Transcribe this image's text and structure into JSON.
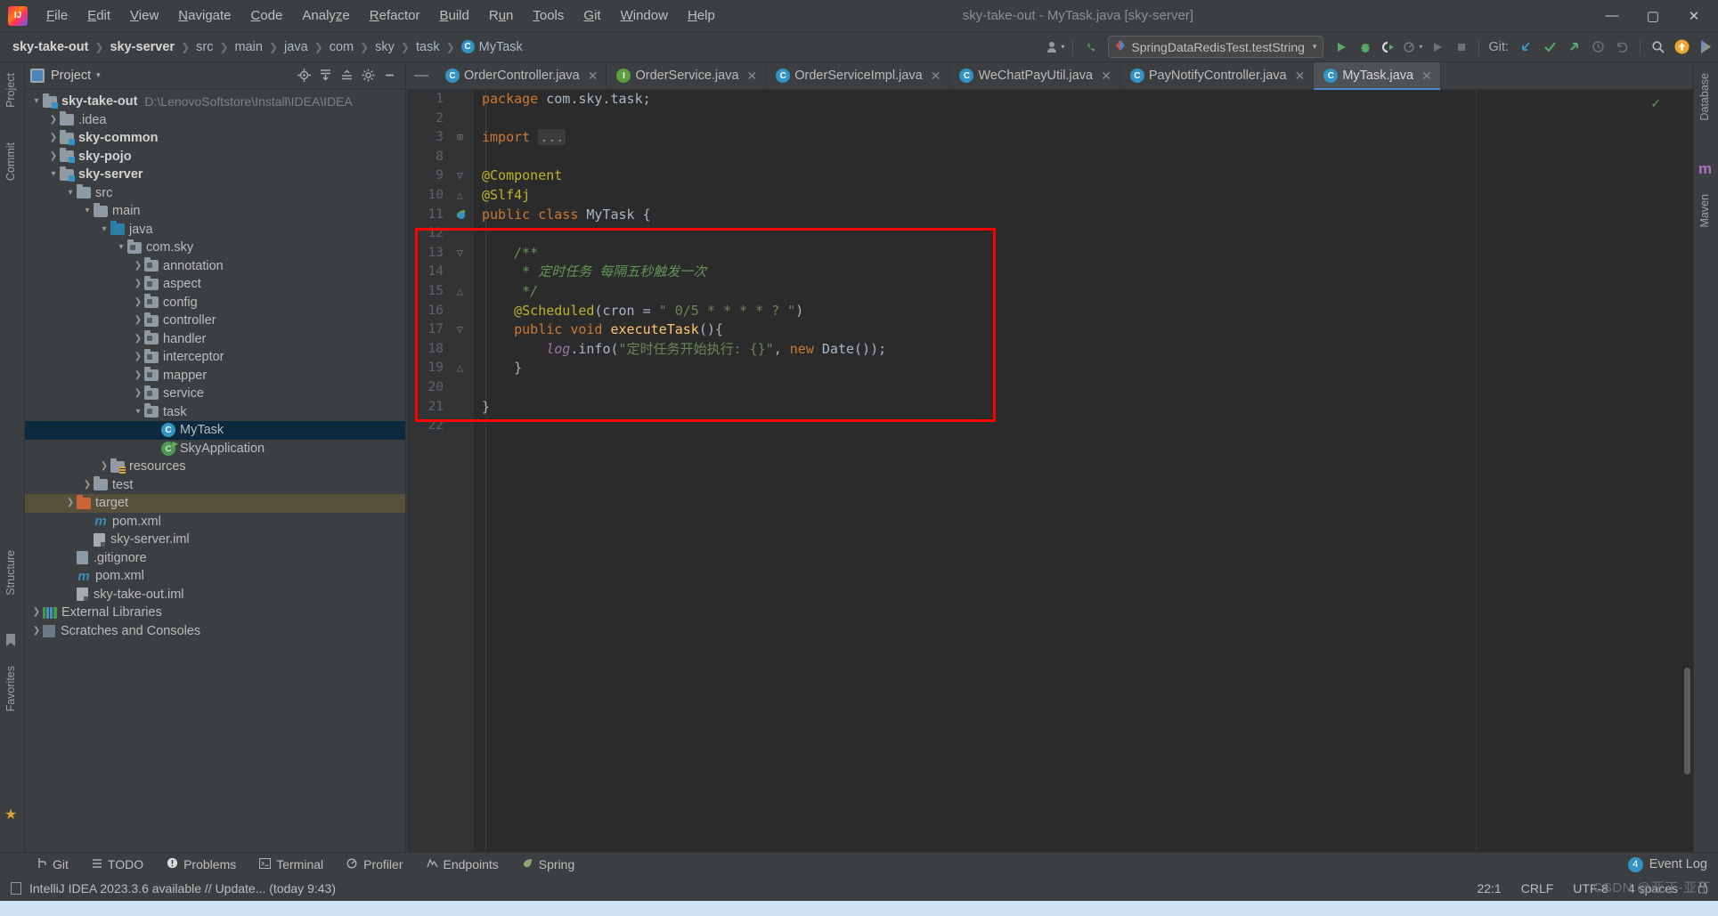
{
  "window": {
    "title": "sky-take-out - MyTask.java [sky-server]",
    "logo": "intellij-idea-logo",
    "minimize": "—",
    "maximize": "▢",
    "close": "✕"
  },
  "menu": [
    {
      "label": "File"
    },
    {
      "label": "Edit"
    },
    {
      "label": "View"
    },
    {
      "label": "Navigate"
    },
    {
      "label": "Code"
    },
    {
      "label": "Analyze"
    },
    {
      "label": "Refactor"
    },
    {
      "label": "Build"
    },
    {
      "label": "Run"
    },
    {
      "label": "Tools"
    },
    {
      "label": "Git"
    },
    {
      "label": "Window"
    },
    {
      "label": "Help"
    }
  ],
  "breadcrumb": {
    "items": [
      {
        "label": "sky-take-out",
        "bold": true
      },
      {
        "label": "sky-server",
        "bold": true
      },
      {
        "label": "src",
        "bold": false
      },
      {
        "label": "main",
        "bold": false
      },
      {
        "label": "java",
        "bold": false
      },
      {
        "label": "com",
        "bold": false
      },
      {
        "label": "sky",
        "bold": false
      },
      {
        "label": "task",
        "bold": false
      },
      {
        "label": "MyTask",
        "bold": false,
        "icon": "class-icon",
        "icon_letter": "C"
      }
    ],
    "separator": "❯"
  },
  "toolbar": {
    "profile_icon": "user-profile-icon",
    "profile_caret": "▾",
    "updates_icon": "updates-arrow-icon",
    "run_config": {
      "icon": "run-config-icon",
      "label": "SpringDataRedisTest.testString",
      "caret": "▾"
    },
    "run_icon": "run-icon",
    "debug_icon": "debug-icon",
    "run_coverage_icon": "run-with-coverage-icon",
    "profile_run_icon": "profiler-icon",
    "profile_caret2": "▾",
    "rerun_icon": "rerun-icon",
    "stop_icon": "stop-icon",
    "git_label": "Git:",
    "git_update_icon": "git-update-project-icon",
    "git_commit_icon": "git-commit-icon",
    "git_push_icon": "git-push-icon",
    "git_history_icon": "git-history-icon",
    "git_rollback_icon": "git-rollback-icon",
    "search_icon": "search-everywhere-icon",
    "notification_icon": "notification-update-icon",
    "ide_icon": "ide-feature-icon"
  },
  "left_strip": [
    {
      "label": "Project",
      "name": "tool-window-project"
    },
    {
      "label": "Commit",
      "name": "tool-window-commit"
    },
    {
      "label": "Structure",
      "name": "tool-window-structure"
    },
    {
      "label": "Favorites",
      "name": "tool-window-favorites"
    }
  ],
  "right_strip": [
    {
      "label": "Database",
      "name": "tool-window-database"
    },
    {
      "label": "Maven",
      "name": "tool-window-maven"
    }
  ],
  "project_panel": {
    "title": "Project",
    "caret": "▾",
    "actions": [
      {
        "icon": "locate-file-icon",
        "glyph": "⊕"
      },
      {
        "icon": "expand-all-icon",
        "glyph": "⤓"
      },
      {
        "icon": "collapse-all-icon",
        "glyph": "⤒"
      },
      {
        "icon": "settings-gear-icon",
        "glyph": "⚙"
      },
      {
        "icon": "hide-panel-icon",
        "glyph": "—"
      }
    ],
    "tree": [
      {
        "label": "sky-take-out",
        "path": "D:\\LenovoSoftstore\\Install\\IDEA\\IDEA",
        "indent": 0,
        "arrow": "▾",
        "icon": "module",
        "bold": true
      },
      {
        "label": ".idea",
        "indent": 1,
        "arrow": "❯",
        "icon": "folder",
        "bold": false
      },
      {
        "label": "sky-common",
        "indent": 1,
        "arrow": "❯",
        "icon": "module",
        "bold": true
      },
      {
        "label": "sky-pojo",
        "indent": 1,
        "arrow": "❯",
        "icon": "module",
        "bold": true
      },
      {
        "label": "sky-server",
        "indent": 1,
        "arrow": "▾",
        "icon": "module",
        "bold": true
      },
      {
        "label": "src",
        "indent": 2,
        "arrow": "▾",
        "icon": "folder",
        "bold": false
      },
      {
        "label": "main",
        "indent": 3,
        "arrow": "▾",
        "icon": "folder",
        "bold": false
      },
      {
        "label": "java",
        "indent": 4,
        "arrow": "▾",
        "icon": "srcjava",
        "bold": false
      },
      {
        "label": "com.sky",
        "indent": 5,
        "arrow": "▾",
        "icon": "pkg",
        "bold": false
      },
      {
        "label": "annotation",
        "indent": 6,
        "arrow": "❯",
        "icon": "pkg",
        "bold": false
      },
      {
        "label": "aspect",
        "indent": 6,
        "arrow": "❯",
        "icon": "pkg",
        "bold": false
      },
      {
        "label": "config",
        "indent": 6,
        "arrow": "❯",
        "icon": "pkg",
        "bold": false
      },
      {
        "label": "controller",
        "indent": 6,
        "arrow": "❯",
        "icon": "pkg",
        "bold": false
      },
      {
        "label": "handler",
        "indent": 6,
        "arrow": "❯",
        "icon": "pkg",
        "bold": false
      },
      {
        "label": "interceptor",
        "indent": 6,
        "arrow": "❯",
        "icon": "pkg",
        "bold": false
      },
      {
        "label": "mapper",
        "indent": 6,
        "arrow": "❯",
        "icon": "pkg",
        "bold": false
      },
      {
        "label": "service",
        "indent": 6,
        "arrow": "❯",
        "icon": "pkg",
        "bold": false
      },
      {
        "label": "task",
        "indent": 6,
        "arrow": "▾",
        "icon": "pkg",
        "bold": false
      },
      {
        "label": "MyTask",
        "indent": 7,
        "arrow": "",
        "icon": "class",
        "bold": false,
        "selected": true
      },
      {
        "label": "SkyApplication",
        "indent": 7,
        "arrow": "",
        "icon": "spring",
        "bold": false
      },
      {
        "label": "resources",
        "indent": 4,
        "arrow": "❯",
        "icon": "resources",
        "bold": false
      },
      {
        "label": "test",
        "indent": 3,
        "arrow": "❯",
        "icon": "folder",
        "bold": false
      },
      {
        "label": "target",
        "indent": 2,
        "arrow": "❯",
        "icon": "target",
        "bold": false,
        "highlight": true
      },
      {
        "label": "pom.xml",
        "indent": 3,
        "arrow": "",
        "icon": "maven",
        "bold": false
      },
      {
        "label": "sky-server.iml",
        "indent": 3,
        "arrow": "",
        "icon": "iml",
        "bold": false
      },
      {
        "label": ".gitignore",
        "indent": 2,
        "arrow": "",
        "icon": "gitignore",
        "bold": false
      },
      {
        "label": "pom.xml",
        "indent": 2,
        "arrow": "",
        "icon": "maven",
        "bold": false
      },
      {
        "label": "sky-take-out.iml",
        "indent": 2,
        "arrow": "",
        "icon": "iml",
        "bold": false
      },
      {
        "label": "External Libraries",
        "indent": 0,
        "arrow": "❯",
        "icon": "library",
        "bold": false
      },
      {
        "label": "Scratches and Consoles",
        "indent": 0,
        "arrow": "❯",
        "icon": "scratch",
        "bold": false
      }
    ]
  },
  "editor_tabs": [
    {
      "label": "OrderController.java",
      "icon": "class-icon",
      "letter": "C",
      "kind": "class",
      "active": false,
      "close": "✕"
    },
    {
      "label": "OrderService.java",
      "icon": "interface-icon",
      "letter": "I",
      "kind": "interface",
      "active": false,
      "close": "✕"
    },
    {
      "label": "OrderServiceImpl.java",
      "icon": "class-icon",
      "letter": "C",
      "kind": "class",
      "active": false,
      "close": "✕"
    },
    {
      "label": "WeChatPayUtil.java",
      "icon": "class-icon",
      "letter": "C",
      "kind": "class",
      "active": false,
      "close": "✕"
    },
    {
      "label": "PayNotifyController.java",
      "icon": "class-icon",
      "letter": "C",
      "kind": "class",
      "active": false,
      "close": "✕"
    },
    {
      "label": "MyTask.java",
      "icon": "class-icon",
      "letter": "C",
      "kind": "class",
      "active": true,
      "close": "✕"
    }
  ],
  "code": {
    "lines": [
      {
        "num": "1",
        "mark": "",
        "tokens": [
          {
            "t": "package ",
            "c": "kw"
          },
          {
            "t": "com.sky.task;",
            "c": "plain"
          }
        ]
      },
      {
        "num": "2",
        "mark": "",
        "tokens": []
      },
      {
        "num": "3",
        "mark": "⊞",
        "tokens": [
          {
            "t": "import ",
            "c": "kw"
          },
          {
            "t": "...",
            "c": "fold"
          }
        ]
      },
      {
        "num": "8",
        "mark": "",
        "tokens": []
      },
      {
        "num": "9",
        "mark": "▽",
        "tokens": [
          {
            "t": "@Component",
            "c": "ann"
          }
        ]
      },
      {
        "num": "10",
        "mark": "△",
        "tokens": [
          {
            "t": "@Slf4j",
            "c": "ann"
          }
        ]
      },
      {
        "num": "11",
        "mark": "",
        "gutter_icon": "spring-bean-icon",
        "tokens": [
          {
            "t": "public ",
            "c": "kw"
          },
          {
            "t": "class ",
            "c": "kw"
          },
          {
            "t": "MyTask ",
            "c": "cls"
          },
          {
            "t": "{",
            "c": "plain"
          }
        ]
      },
      {
        "num": "12",
        "mark": "",
        "tokens": []
      },
      {
        "num": "13",
        "mark": "▽",
        "tokens": [
          {
            "t": "    /**",
            "c": "cmt"
          }
        ]
      },
      {
        "num": "14",
        "mark": "",
        "tokens": [
          {
            "t": "     * 定时任务 每隔五秒触发一次",
            "c": "cmt"
          }
        ]
      },
      {
        "num": "15",
        "mark": "△",
        "tokens": [
          {
            "t": "     */",
            "c": "cmt"
          }
        ]
      },
      {
        "num": "16",
        "mark": "",
        "tokens": [
          {
            "t": "    @Scheduled",
            "c": "ann"
          },
          {
            "t": "(",
            "c": "plain"
          },
          {
            "t": "cron ",
            "c": "param"
          },
          {
            "t": "= ",
            "c": "plain"
          },
          {
            "t": "\" 0/5 * * * * ? \"",
            "c": "str"
          },
          {
            "t": ")",
            "c": "plain"
          }
        ]
      },
      {
        "num": "17",
        "mark": "▽",
        "tokens": [
          {
            "t": "    public ",
            "c": "kw"
          },
          {
            "t": "void ",
            "c": "kw"
          },
          {
            "t": "executeTask",
            "c": "mth"
          },
          {
            "t": "(){",
            "c": "plain"
          }
        ]
      },
      {
        "num": "18",
        "mark": "",
        "tokens": [
          {
            "t": "        log",
            "c": "fld"
          },
          {
            "t": ".",
            "c": "plain"
          },
          {
            "t": "info",
            "c": "plain"
          },
          {
            "t": "(",
            "c": "plain"
          },
          {
            "t": "\"定时任务开始执行: {}\"",
            "c": "str"
          },
          {
            "t": ", ",
            "c": "plain"
          },
          {
            "t": "new ",
            "c": "kw"
          },
          {
            "t": "Date",
            "c": "plain"
          },
          {
            "t": "());",
            "c": "plain"
          }
        ]
      },
      {
        "num": "19",
        "mark": "△",
        "tokens": [
          {
            "t": "    }",
            "c": "plain"
          }
        ]
      },
      {
        "num": "20",
        "mark": "",
        "tokens": []
      },
      {
        "num": "21",
        "mark": "",
        "tokens": [
          {
            "t": "}",
            "c": "plain"
          }
        ]
      },
      {
        "num": "22",
        "mark": "",
        "tokens": []
      }
    ],
    "inspection_status": "✓",
    "highlight_box": "red-annotation-box"
  },
  "bottom_bar": {
    "items": [
      {
        "label": "Git",
        "icon": "git-branch-icon",
        "glyph": "⑂"
      },
      {
        "label": "TODO",
        "icon": "todo-icon",
        "glyph": "☰"
      },
      {
        "label": "Problems",
        "icon": "problems-icon",
        "glyph": "❶"
      },
      {
        "label": "Terminal",
        "icon": "terminal-icon",
        "glyph": "▣"
      },
      {
        "label": "Profiler",
        "icon": "profiler-icon",
        "glyph": "◔"
      },
      {
        "label": "Endpoints",
        "icon": "endpoints-icon",
        "glyph": "⋀"
      },
      {
        "label": "Spring",
        "icon": "spring-leaf-icon",
        "glyph": "🍃"
      }
    ],
    "event_log": {
      "count": "4",
      "label": "Event Log"
    }
  },
  "status_bar": {
    "message": "IntelliJ IDEA 2023.3.6 available // Update... (today 9:43)",
    "doc_icon": "notification-icon",
    "caret_position": "22:1",
    "line_separator": "CRLF",
    "encoding": "UTF-8",
    "indent": "4 spaces",
    "lock_icon": "lock-icon"
  },
  "watermark": "CSDN @亚丁-亚丁"
}
